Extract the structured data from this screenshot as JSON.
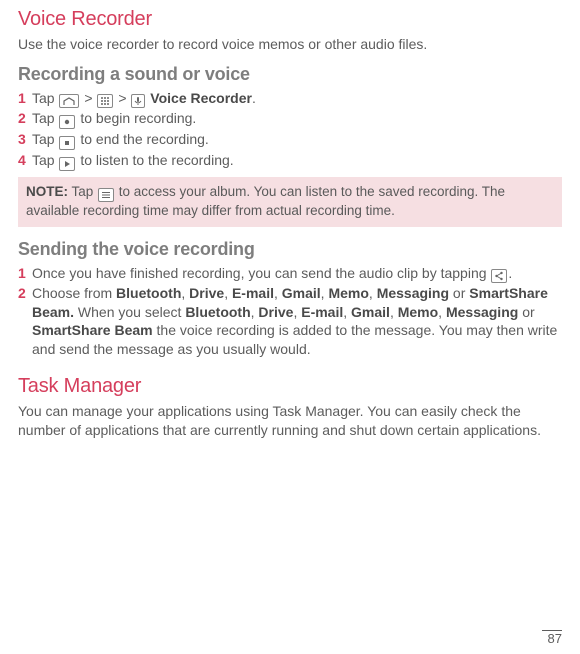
{
  "voiceRecorder": {
    "title": "Voice Recorder",
    "intro": "Use the voice recorder to record voice memos or other audio files.",
    "recordingHeading": "Recording a sound or voice",
    "steps": {
      "s1a": "Tap ",
      "s1b": " > ",
      "s1c": " > ",
      "s1d": " Voice Recorder",
      "s1e": ".",
      "s2a": "Tap ",
      "s2b": " to begin recording.",
      "s3a": "Tap ",
      "s3b": " to end the recording.",
      "s4a": "Tap ",
      "s4b": " to listen to the recording."
    },
    "note": {
      "label": "NOTE:",
      "a": " Tap ",
      "b": " to access your album. You can listen to the saved recording. The available recording time may differ from actual recording time."
    },
    "sendingHeading": "Sending the voice recording",
    "send": {
      "s1a": "Once you have finished recording, you can send the audio clip by tapping ",
      "s1b": ".",
      "s2a": "Choose from ",
      "bt": "Bluetooth",
      "c1": ", ",
      "drive": "Drive",
      "c2": ", ",
      "email": "E-mail",
      "c3": ", ",
      "gmail": "Gmail",
      "c4": ", ",
      "memo": "Memo",
      "c5": ", ",
      "msg": "Messaging",
      "or1": " or ",
      "ssb": "SmartShare Beam.",
      "mid": " When you select ",
      "bt2": "Bluetooth",
      "c6": ", ",
      "drive2": "Drive",
      "c7": ", ",
      "email2": "E-mail",
      "c8": ", ",
      "gmail2": "Gmail",
      "c9": ", ",
      "memo2": "Memo",
      "c10": ", ",
      "msg2": "Messaging",
      "or2": " or ",
      "ssb2": "SmartShare Beam",
      "tail": " the voice recording is added to the message. You may then write and send the message as you usually would."
    }
  },
  "taskManager": {
    "title": "Task Manager",
    "body": "You can manage your applications using Task Manager. You can easily check the number of applications that are currently running and shut down certain applications."
  },
  "pageNumber": "87"
}
